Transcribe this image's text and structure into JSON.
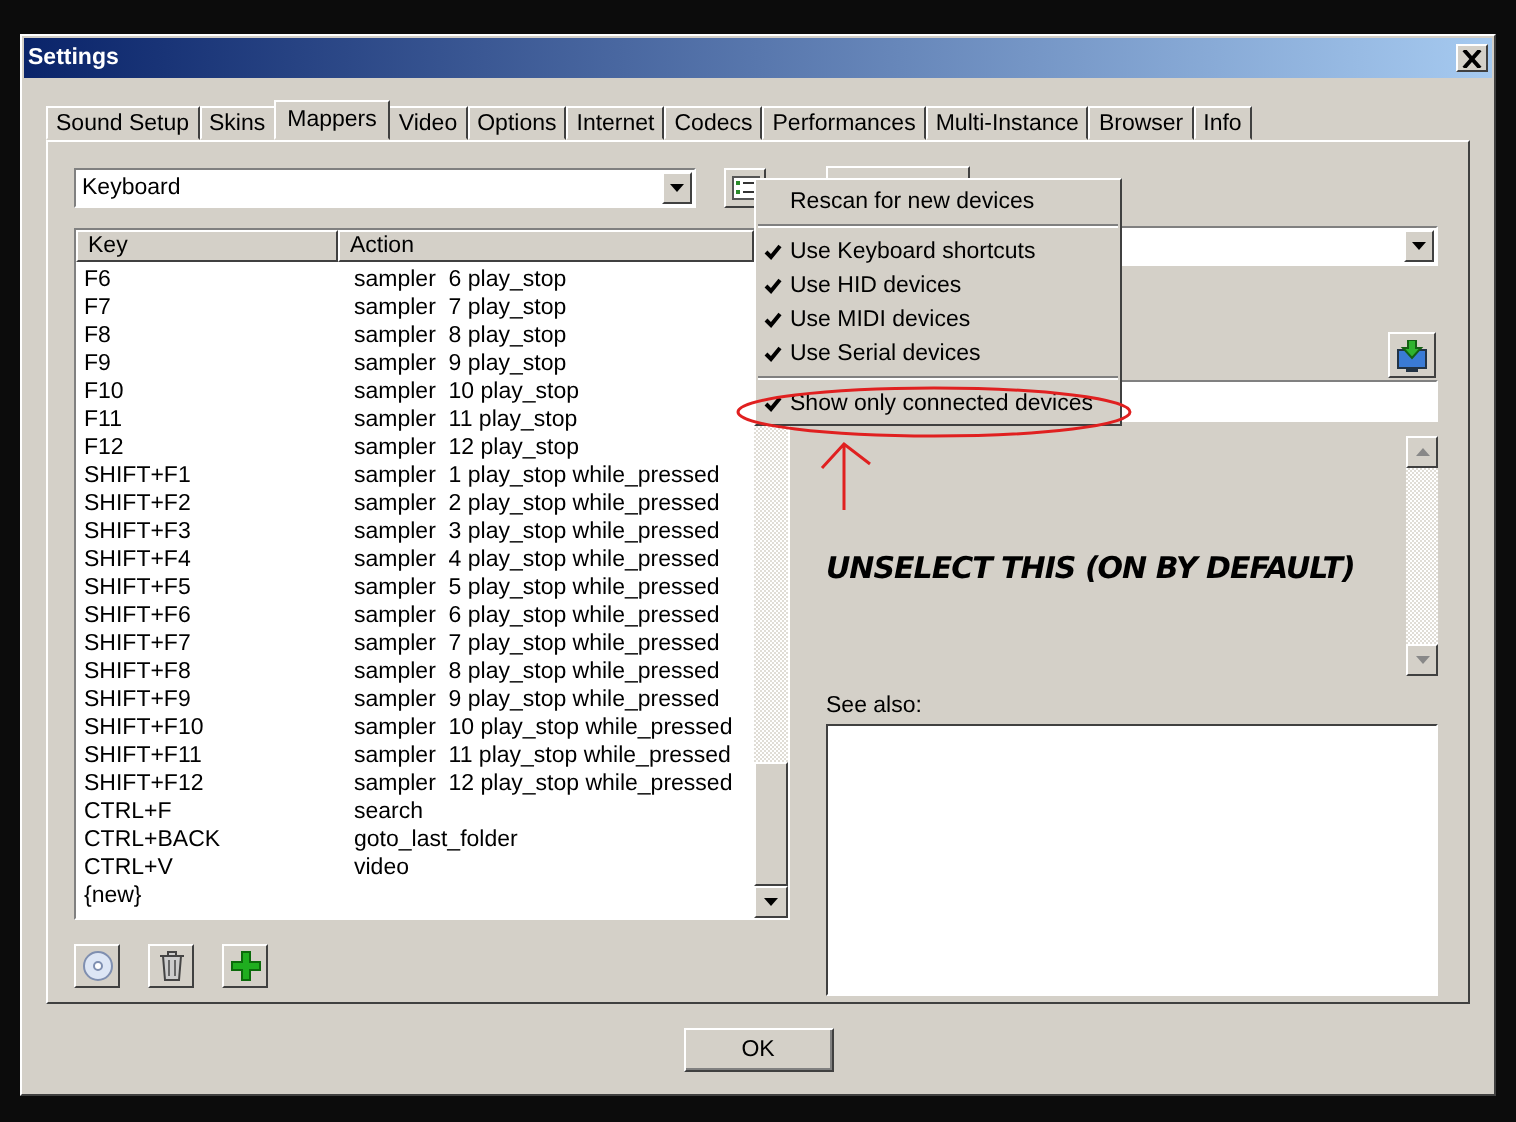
{
  "window": {
    "title": "Settings"
  },
  "tabs": [
    {
      "label": "Sound Setup",
      "selected": false
    },
    {
      "label": "Skins",
      "selected": false
    },
    {
      "label": "Mappers",
      "selected": true
    },
    {
      "label": "Video",
      "selected": false
    },
    {
      "label": "Options",
      "selected": false
    },
    {
      "label": "Internet",
      "selected": false
    },
    {
      "label": "Codecs",
      "selected": false
    },
    {
      "label": "Performances",
      "selected": false
    },
    {
      "label": "Multi-Instance",
      "selected": false
    },
    {
      "label": "Browser",
      "selected": false
    },
    {
      "label": "Info",
      "selected": false
    }
  ],
  "device_combo": {
    "value": "Keyboard"
  },
  "table": {
    "columns": [
      "Key",
      "Action"
    ],
    "rows": [
      {
        "key": "F6",
        "action": "sampler  6 play_stop"
      },
      {
        "key": "F7",
        "action": "sampler  7 play_stop"
      },
      {
        "key": "F8",
        "action": "sampler  8 play_stop"
      },
      {
        "key": "F9",
        "action": "sampler  9 play_stop"
      },
      {
        "key": "F10",
        "action": "sampler  10 play_stop"
      },
      {
        "key": "F11",
        "action": "sampler  11 play_stop"
      },
      {
        "key": "F12",
        "action": "sampler  12 play_stop"
      },
      {
        "key": "SHIFT+F1",
        "action": "sampler  1 play_stop while_pressed"
      },
      {
        "key": "SHIFT+F2",
        "action": "sampler  2 play_stop while_pressed"
      },
      {
        "key": "SHIFT+F3",
        "action": "sampler  3 play_stop while_pressed"
      },
      {
        "key": "SHIFT+F4",
        "action": "sampler  4 play_stop while_pressed"
      },
      {
        "key": "SHIFT+F5",
        "action": "sampler  5 play_stop while_pressed"
      },
      {
        "key": "SHIFT+F6",
        "action": "sampler  6 play_stop while_pressed"
      },
      {
        "key": "SHIFT+F7",
        "action": "sampler  7 play_stop while_pressed"
      },
      {
        "key": "SHIFT+F8",
        "action": "sampler  8 play_stop while_pressed"
      },
      {
        "key": "SHIFT+F9",
        "action": "sampler  9 play_stop while_pressed"
      },
      {
        "key": "SHIFT+F10",
        "action": "sampler  10 play_stop while_pressed"
      },
      {
        "key": "SHIFT+F11",
        "action": "sampler  11 play_stop while_pressed"
      },
      {
        "key": "SHIFT+F12",
        "action": "sampler  12 play_stop while_pressed"
      },
      {
        "key": "CTRL+F",
        "action": "search"
      },
      {
        "key": "CTRL+BACK",
        "action": "goto_last_folder"
      },
      {
        "key": "CTRL+V",
        "action": "video"
      },
      {
        "key": "{new}",
        "action": ""
      }
    ]
  },
  "menu": [
    {
      "kind": "command",
      "label": "Rescan for new devices"
    },
    {
      "kind": "separator"
    },
    {
      "kind": "check",
      "label": "Use Keyboard shortcuts",
      "checked": true
    },
    {
      "kind": "check",
      "label": "Use HID devices",
      "checked": true
    },
    {
      "kind": "check",
      "label": "Use MIDI devices",
      "checked": true
    },
    {
      "kind": "check",
      "label": "Use Serial devices",
      "checked": true
    },
    {
      "kind": "separator"
    },
    {
      "kind": "check",
      "label": "Show only connected devices",
      "checked": true
    }
  ],
  "annotation": {
    "text": "UNSELECT THIS (ON BY DEFAULT)"
  },
  "see_also": {
    "label": "See also:"
  },
  "buttons": [
    "OK"
  ]
}
